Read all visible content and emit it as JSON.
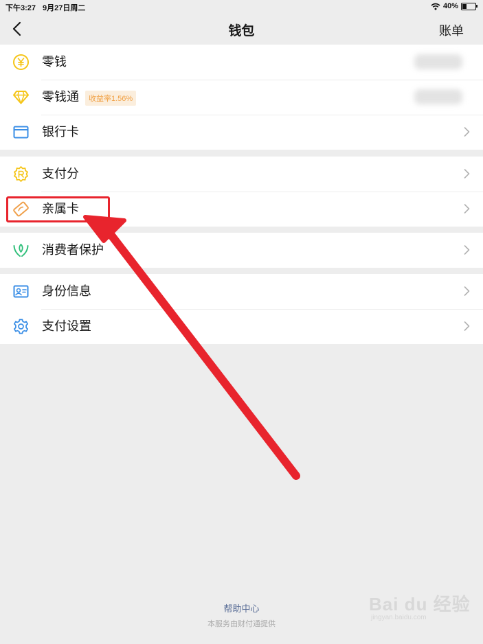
{
  "status_bar": {
    "time": "下午3:27",
    "date": "9月27日周二",
    "battery": "40%",
    "battery_level": 0.4
  },
  "navbar": {
    "back_icon": "chevron-left-icon",
    "title": "钱包",
    "right_action": "账单"
  },
  "groups": [
    {
      "items": [
        {
          "label": "零钱",
          "icon": "yuan-coin-icon",
          "color": "#f5c518"
        },
        {
          "label": "零钱通",
          "icon": "diamond-icon",
          "color": "#f5c518",
          "badge": "收益率1.56%"
        },
        {
          "label": "银行卡",
          "icon": "bank-card-icon",
          "color": "#3a8ee6"
        }
      ]
    },
    {
      "items": [
        {
          "label": "支付分",
          "icon": "score-badge-icon",
          "color": "#f5c518"
        },
        {
          "label": "亲属卡",
          "icon": "family-card-icon",
          "color": "#f0a04b"
        }
      ]
    },
    {
      "items": [
        {
          "label": "消费者保护",
          "icon": "hands-leaf-icon",
          "color": "#2fbf7a"
        }
      ]
    },
    {
      "items": [
        {
          "label": "身份信息",
          "icon": "id-card-icon",
          "color": "#3a8ee6"
        },
        {
          "label": "支付设置",
          "icon": "gear-icon",
          "color": "#3a8ee6"
        }
      ]
    }
  ],
  "annotation": {
    "highlight_color": "#e8242d"
  },
  "footer": {
    "help_link": "帮助中心",
    "note": "本服务由财付通提供"
  },
  "watermark": {
    "main": "Bai du 经验",
    "sub": "jingyan.baidu.com"
  }
}
